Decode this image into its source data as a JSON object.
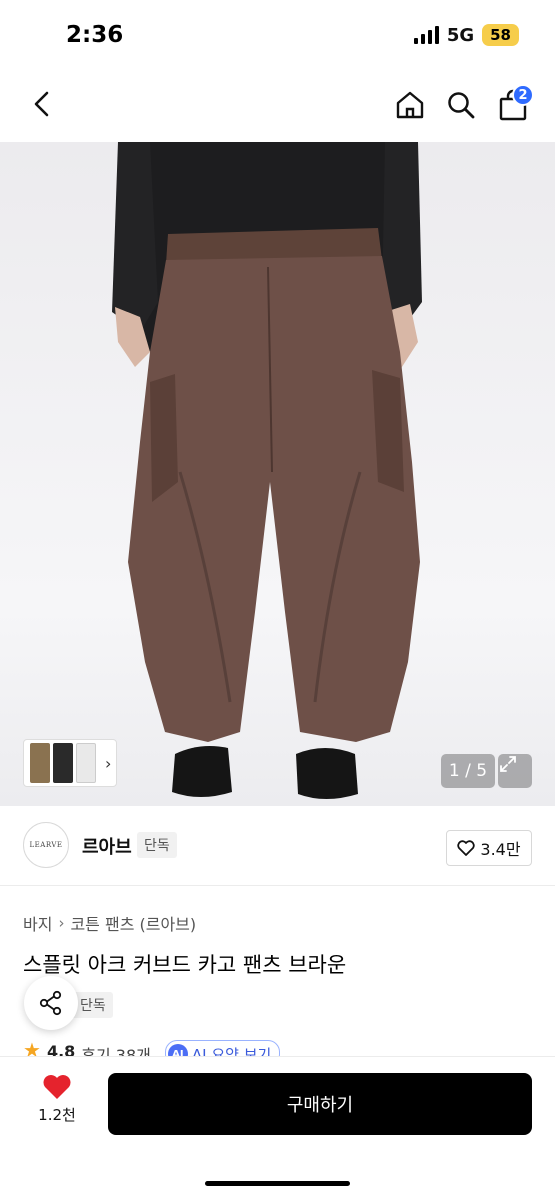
{
  "status_bar": {
    "time": "2:36",
    "network": "5G",
    "battery": "58"
  },
  "nav": {
    "back_icon": "chevron-left-icon",
    "home_icon": "home-icon",
    "search_icon": "search-icon",
    "bag_icon": "shopping-bag-icon",
    "cart_count": "2"
  },
  "gallery": {
    "counter": "1 / 5",
    "expand_icon": "expand-icon"
  },
  "brand": {
    "logo_text": "LEARVE",
    "name": "르아브",
    "tag": "단독",
    "likes": "3.4만"
  },
  "product": {
    "breadcrumb": [
      "바지",
      "코튼 팬츠 (르아브)"
    ],
    "title": "스플릿 아크 커브드 카고 팬츠 브라운",
    "exclusive_tag": "단독",
    "rating": "4.8",
    "reviews": "후기 38개",
    "ai_summary": "AI 요약 보기"
  },
  "bottom_bar": {
    "wish_count": "1.2천",
    "buy_label": "구매하기"
  },
  "colors": {
    "accent_blue": "#2f6bff",
    "heart_red": "#e5232d",
    "buy_black": "#000000",
    "battery_yellow": "#f6cd4b"
  }
}
